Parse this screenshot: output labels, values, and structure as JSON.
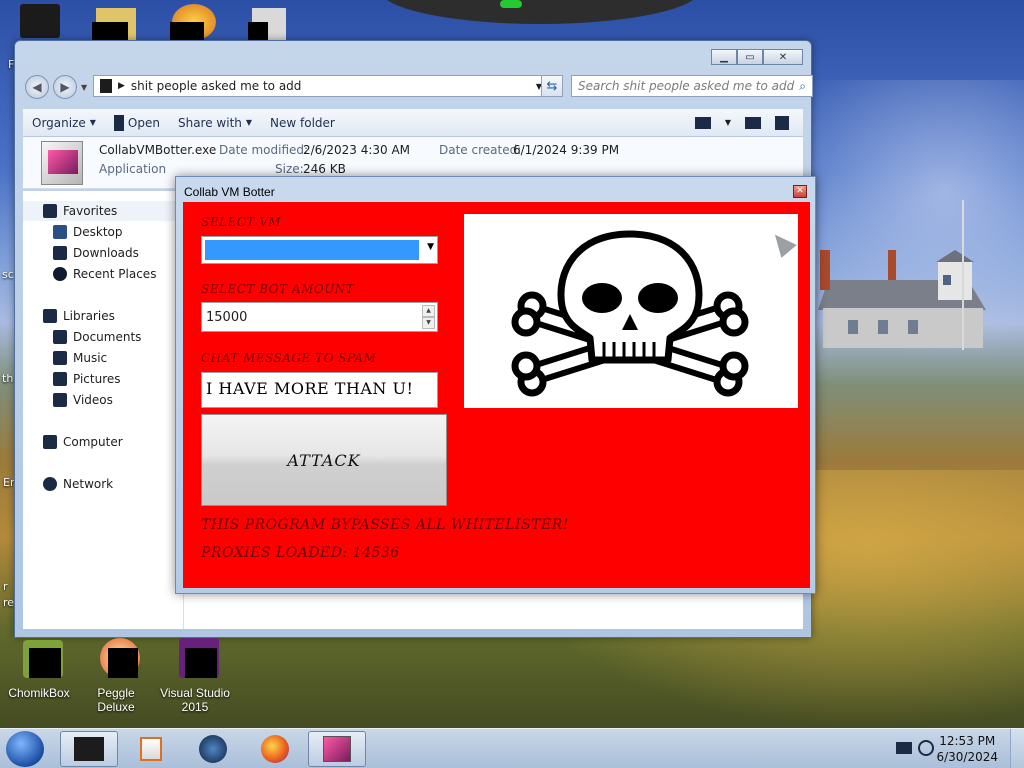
{
  "explorer": {
    "address": "shit people asked me to add",
    "search_placeholder": "Search shit people asked me to add",
    "toolbar": {
      "organize": "Organize",
      "open": "Open",
      "share_with": "Share with",
      "new_folder": "New folder"
    },
    "details": {
      "file_name": "CollabVMBotter.exe",
      "file_type": "Application",
      "modified_label": "Date modified:",
      "modified_value": "2/6/2023 4:30 AM",
      "created_label": "Date created:",
      "created_value": "6/1/2024 9:39 PM",
      "size_label": "Size:",
      "size_value": "246 KB"
    },
    "nav": {
      "favorites": "Favorites",
      "desktop": "Desktop",
      "downloads": "Downloads",
      "recent_places": "Recent Places",
      "libraries": "Libraries",
      "documents": "Documents",
      "music": "Music",
      "pictures": "Pictures",
      "videos": "Videos",
      "computer": "Computer",
      "network": "Network"
    }
  },
  "bot": {
    "title": "Collab VM Botter",
    "select_vm_label": "SELECT VM",
    "bot_amount_label": "SELECT BOT AMOUNT",
    "bot_amount_value": "15000",
    "chat_label": "CHAT MESSAGE TO SPAM",
    "chat_value": "I HAVE MORE THAN U!",
    "attack_label": "ATTACK",
    "bypass_text": "THIS PROGRAM BYPASSES ALL WHITELISTER!",
    "proxies_text": "PROXIES LOADED: 14536"
  },
  "desktop_icons": [
    {
      "label": "ChomikBox"
    },
    {
      "label": "Peggle Deluxe"
    },
    {
      "label": "Visual Studio 2015"
    }
  ],
  "edge_labels": {
    "f": "F",
    "sc": "sc",
    "th": "th",
    "er": "Er",
    "r": "r",
    "re": "re"
  },
  "taskbar": {
    "time": "12:53 PM",
    "date": "6/30/2024"
  },
  "colors": {
    "bot_bg": "#ff0000",
    "selection": "#3399ff",
    "skull": "#000000"
  }
}
